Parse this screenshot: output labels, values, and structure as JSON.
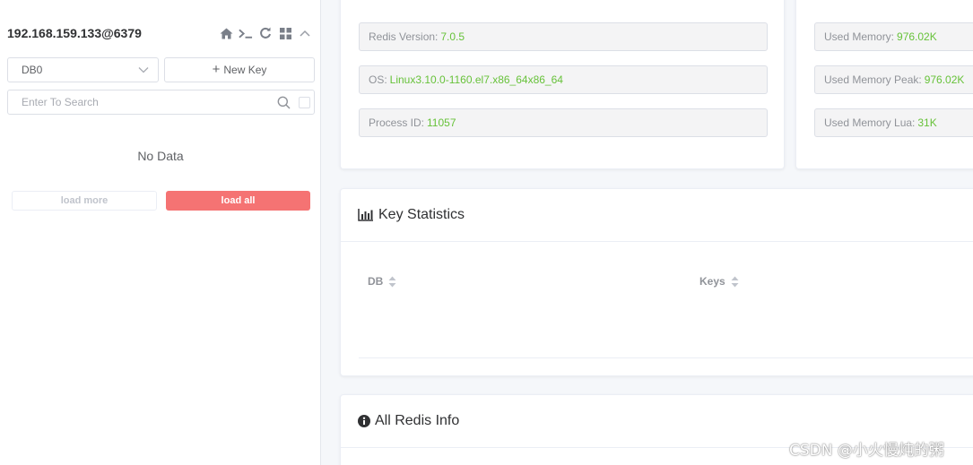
{
  "sidebar": {
    "connection_title": "192.168.159.133@6379",
    "db_select_value": "DB0",
    "new_key_label": "New Key",
    "search_placeholder": "Enter To Search",
    "empty_text": "No Data",
    "load_more_label": "load more",
    "load_all_label": "load all",
    "icons": [
      "home-icon",
      "terminal-icon",
      "refresh-icon",
      "grid-icon",
      "chevron-up-icon"
    ]
  },
  "server_info": {
    "redis_version_label": "Redis Version:",
    "redis_version": "7.0.5",
    "os_label": "OS:",
    "os": "Linux3.10.0-1160.el7.x86_64x86_64",
    "process_id_label": "Process ID:",
    "process_id": "11057"
  },
  "memory_info": {
    "used_memory_label": "Used Memory:",
    "used_memory": "976.02K",
    "used_memory_peak_label": "Used Memory Peak:",
    "used_memory_peak": "976.02K",
    "used_memory_lua_label": "Used Memory Lua:",
    "used_memory_lua": "31K"
  },
  "key_statistics": {
    "title": "Key Statistics",
    "columns": [
      "DB",
      "Keys"
    ]
  },
  "all_redis_info": {
    "title": "All Redis Info"
  },
  "watermark": "CSDN @小火慢炖的粥",
  "colors": {
    "value_green": "#67c23a",
    "danger": "#f56c6c",
    "border": "#dcdfe6",
    "muted_text": "#909399"
  }
}
